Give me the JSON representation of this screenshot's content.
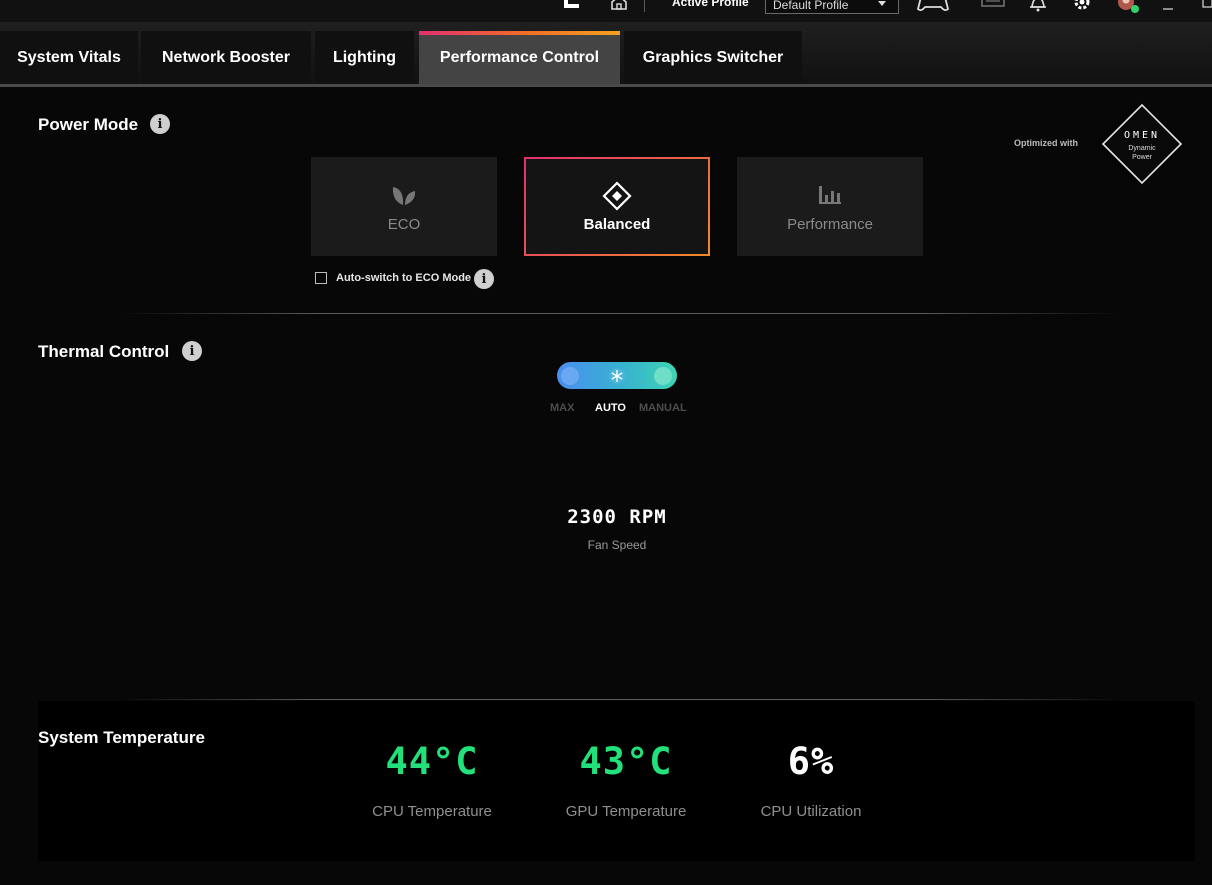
{
  "topbar": {
    "active_profile_label": "Active Profile",
    "profile_value": "Default Profile"
  },
  "tabs": [
    {
      "label": "System Vitals",
      "active": false
    },
    {
      "label": "Network Booster",
      "active": false
    },
    {
      "label": "Lighting",
      "active": false
    },
    {
      "label": "Performance Control",
      "active": true
    },
    {
      "label": "Graphics Switcher",
      "active": false
    }
  ],
  "power_mode": {
    "title": "Power Mode",
    "modes": [
      {
        "label": "ECO",
        "icon": "leaf-icon",
        "selected": false
      },
      {
        "label": "Balanced",
        "icon": "diamond-icon",
        "selected": true
      },
      {
        "label": "Performance",
        "icon": "bar-chart-icon",
        "selected": false
      }
    ],
    "auto_switch_label": "Auto-switch to ECO Mode",
    "auto_switch_checked": false,
    "optimized_label": "Optimized with",
    "badge": {
      "brand": "OMEN",
      "line1": "Dynamic",
      "line2": "Power"
    }
  },
  "thermal": {
    "title": "Thermal Control",
    "options": [
      "MAX",
      "AUTO",
      "MANUAL"
    ],
    "selected": "AUTO",
    "fan_speed_value": "2300 RPM",
    "fan_speed_label": "Fan Speed"
  },
  "temperature": {
    "title": "System Temperature",
    "metrics": [
      {
        "value": "44°C",
        "label": "CPU Temperature",
        "color": "#22e07a"
      },
      {
        "value": "43°C",
        "label": "GPU Temperature",
        "color": "#22e07a"
      },
      {
        "value": "6%",
        "label": "CPU Utilization",
        "color": "#ffffff"
      }
    ]
  },
  "colors": {
    "accent_gradient_start": "#e2306f",
    "accent_gradient_end": "#f2a21e",
    "thermal_gradient": "#4a8ff0"
  }
}
